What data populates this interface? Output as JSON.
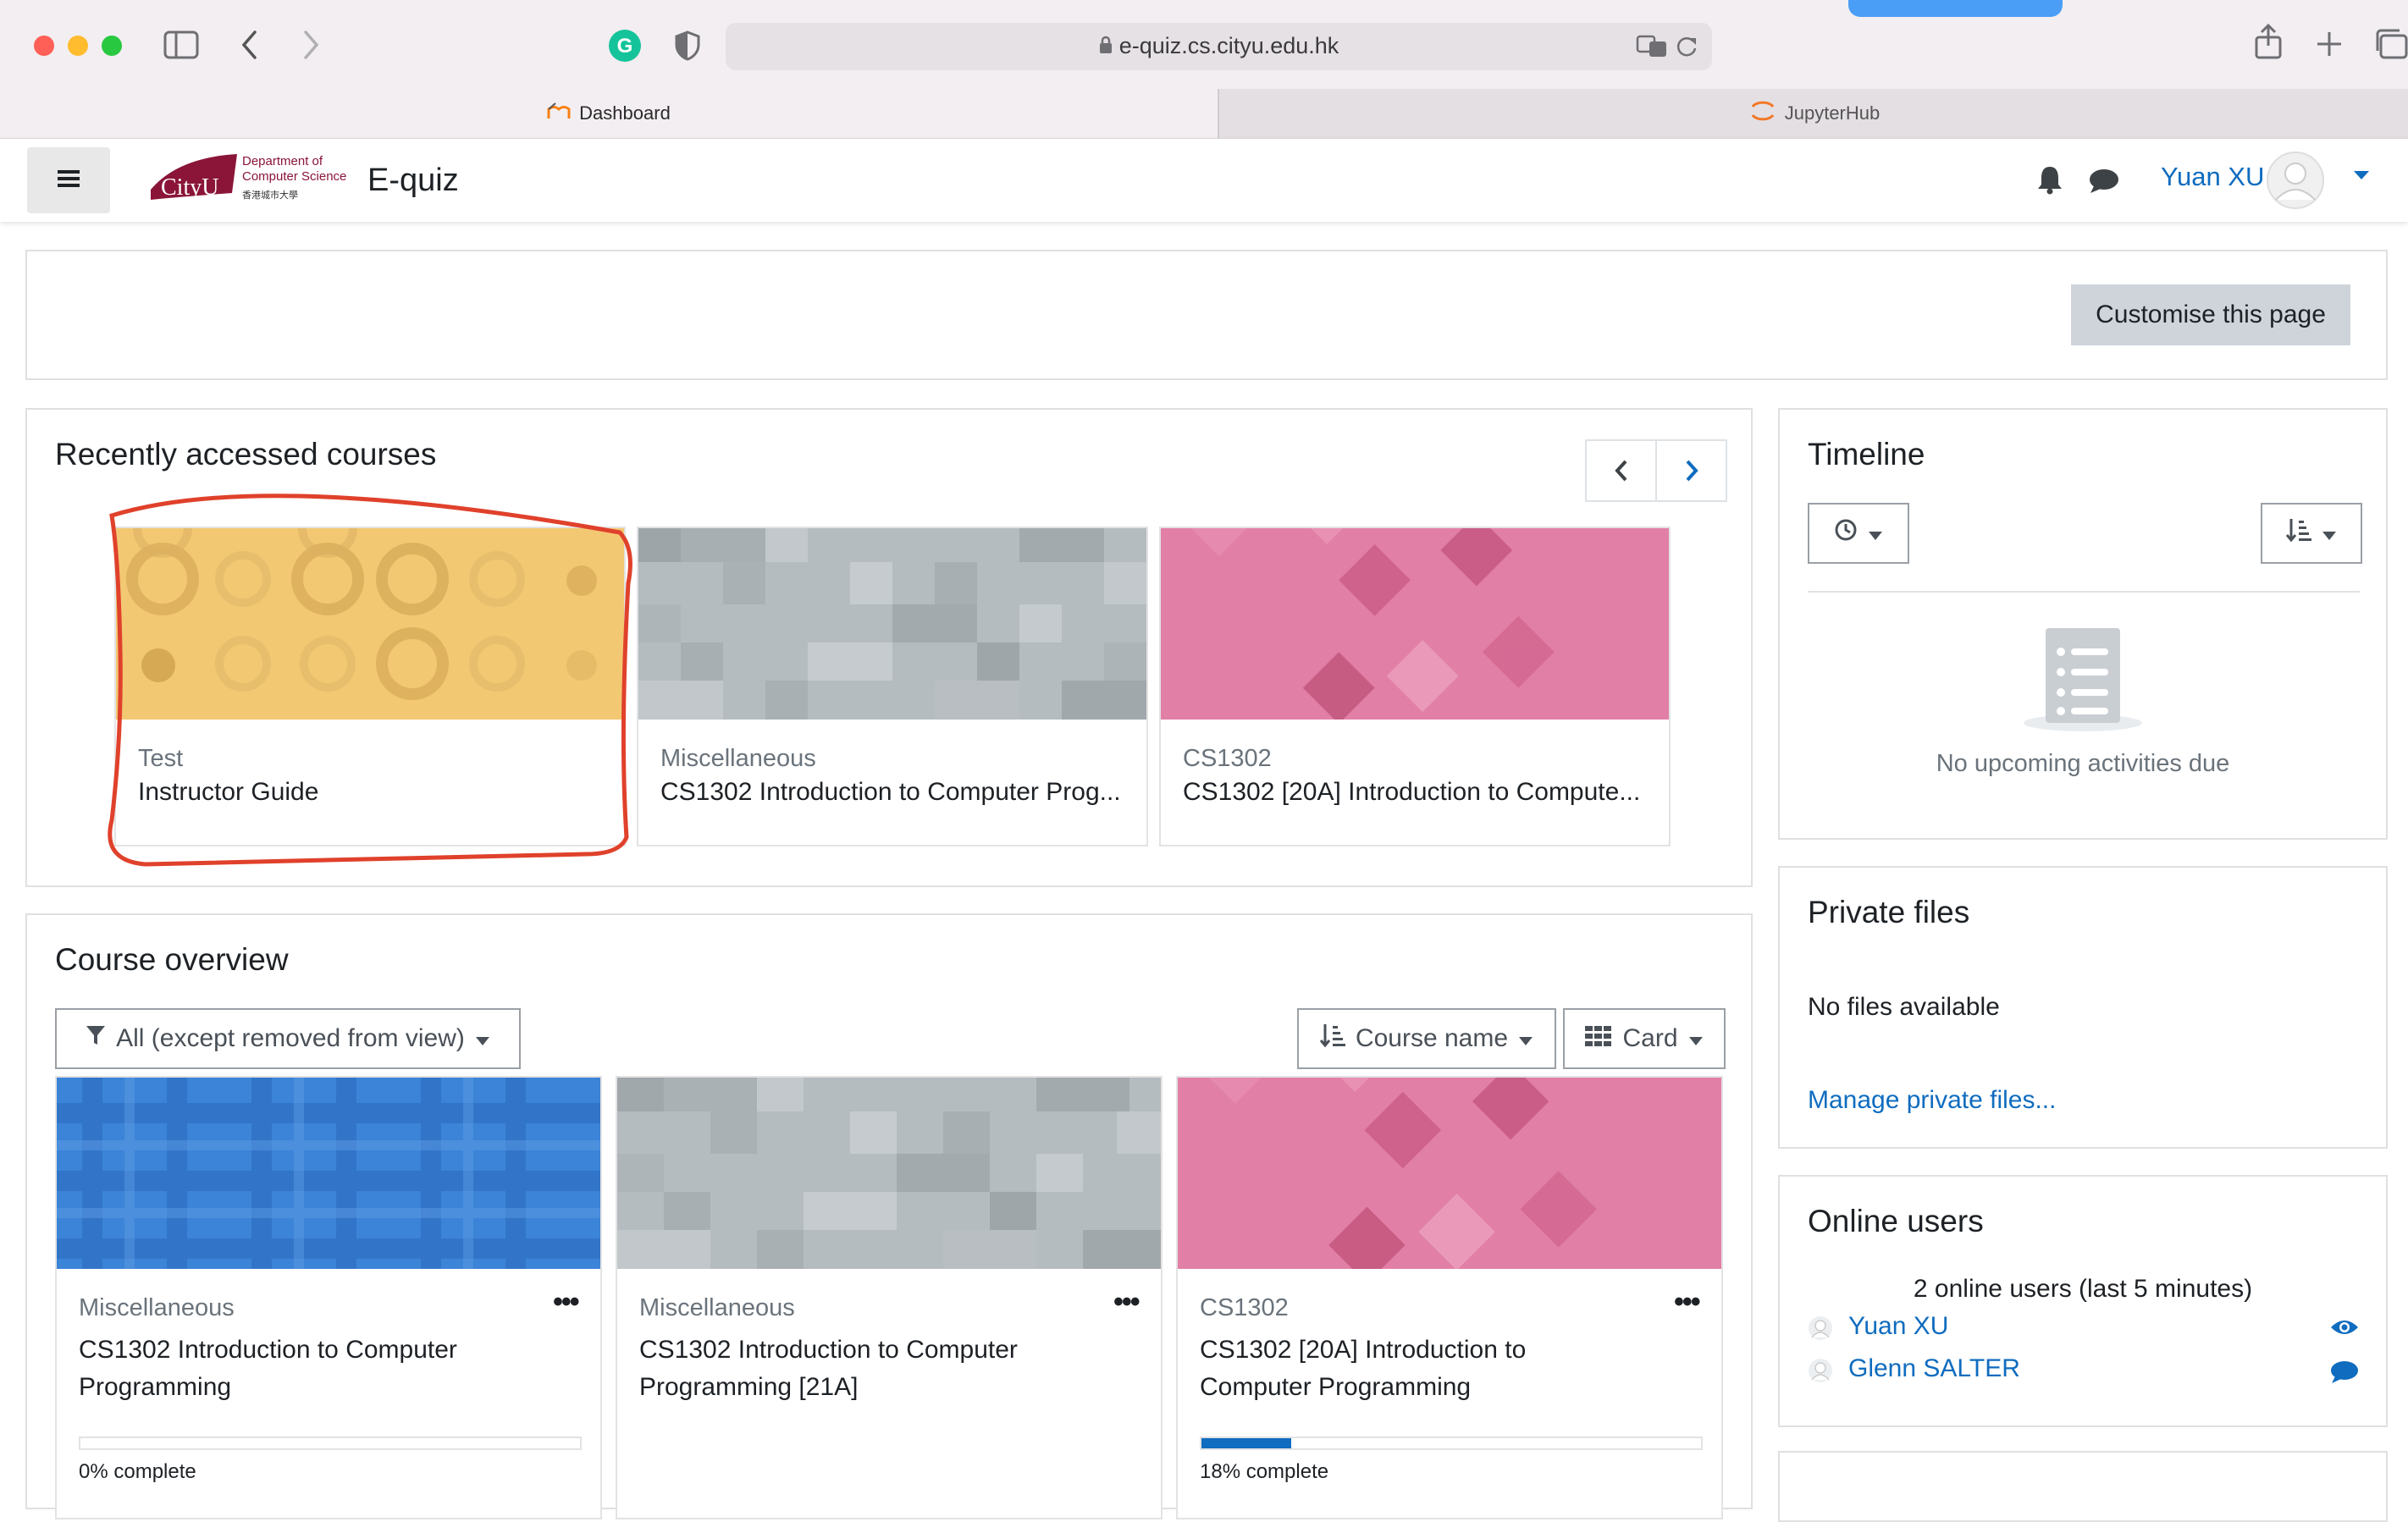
{
  "browser": {
    "url": "e-quiz.cs.cityu.edu.hk",
    "tabs": [
      {
        "label": "Dashboard"
      },
      {
        "label": "JupyterHub"
      }
    ]
  },
  "header": {
    "site_title": "E-quiz",
    "logo_text": "CityU",
    "logo_sub1": "Department of",
    "logo_sub2": "Computer Science",
    "logo_sub3": "香港城市大學",
    "user_name": "Yuan XU"
  },
  "customise": {
    "button_label": "Customise this page"
  },
  "recent": {
    "title": "Recently accessed courses",
    "courses": [
      {
        "category": "Test",
        "name": "Instructor Guide"
      },
      {
        "category": "Miscellaneous",
        "name": "CS1302 Introduction to Computer Prog..."
      },
      {
        "category": "CS1302",
        "name": "CS1302 [20A] Introduction to Compute..."
      }
    ]
  },
  "overview": {
    "title": "Course overview",
    "filter_label": "All (except removed from view)",
    "sort_label": "Course name",
    "view_label": "Card",
    "courses": [
      {
        "category": "Miscellaneous",
        "name_line1": "CS1302 Introduction to Computer",
        "name_line2": "Programming",
        "progress_text": "0% complete",
        "progress": 0
      },
      {
        "category": "Miscellaneous",
        "name_line1": "CS1302 Introduction to Computer",
        "name_line2": "Programming [21A]"
      },
      {
        "category": "CS1302",
        "name_line1": "CS1302 [20A] Introduction to",
        "name_line2": "Computer Programming",
        "progress_text": "18% complete",
        "progress": 18
      }
    ]
  },
  "timeline": {
    "title": "Timeline",
    "empty_text": "No upcoming activities due"
  },
  "private_files": {
    "title": "Private files",
    "empty_text": "No files available",
    "manage_link": "Manage private files..."
  },
  "online_users": {
    "title": "Online users",
    "summary": "2 online users (last 5 minutes)",
    "users": [
      {
        "name": "Yuan XU"
      },
      {
        "name": "Glenn SALTER"
      }
    ]
  },
  "colors": {
    "link": "#0f6cbf",
    "annotation_red": "#e0412b",
    "progress_blue": "#0f6cbf"
  },
  "icons": [
    "sidebar-icon",
    "back-icon",
    "forward-icon",
    "grammarly-icon",
    "shield-icon",
    "lock-icon",
    "translate-icon",
    "reload-icon",
    "share-icon",
    "new-tab-icon",
    "tabs-icon",
    "menu-icon",
    "bell-icon",
    "chat-icon",
    "avatar-icon",
    "caret-down-icon",
    "chevron-left-icon",
    "chevron-right-icon",
    "clock-icon",
    "sort-icon",
    "filter-icon",
    "grid-icon",
    "ellipsis-icon",
    "eye-icon",
    "message-icon",
    "user-icon",
    "list-empty-icon"
  ]
}
